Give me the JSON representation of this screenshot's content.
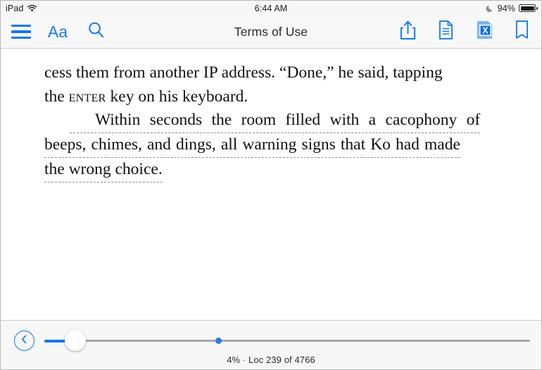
{
  "status_bar": {
    "device": "iPad",
    "wifi_icon": "wifi-icon",
    "time": "6:44 AM",
    "do_not_disturb_icon": "moon-icon",
    "battery_percent": "94%",
    "battery_icon": "battery-icon",
    "battery_level": 94
  },
  "toolbar": {
    "title": "Terms of Use",
    "menu_icon": "hamburger-menu-icon",
    "font_label": "Aa",
    "search_icon": "search-icon",
    "share_icon": "share-icon",
    "notes_icon": "notebook-icon",
    "xray_icon": "x-ray-icon",
    "bookmark_icon": "bookmark-icon"
  },
  "content": {
    "paragraph_1": {
      "line_1": "cess them from another IP address. “Done,” he said, tapping",
      "line_2_before": "the ",
      "line_2_smallcaps": "enter",
      "line_2_after": " key on his keyboard."
    },
    "note_passage": {
      "line_1": "Within seconds the room filled with a cacophony of",
      "line_2": "beeps, chimes, and dings, all warning signs that Ko had made",
      "line_3": "the wrong choice.",
      "full_text": "Within seconds the room filled with a cacophony of beeps, chimes, and dings, all warning signs that Ko had made the wrong choice."
    }
  },
  "bottom_bar": {
    "back_button_icon": "chevron-left-circle-icon",
    "progress_label": "4% · Loc 239 of 4766",
    "slider": {
      "value_percent": 4,
      "marker_percent": 35
    }
  },
  "colors": {
    "accent_blue": "#1479e8",
    "marker_blue": "#2b7de0",
    "toolbar_bg": "#f8f8f8",
    "page_bg": "#ffffff",
    "note_underline": "#8c8c8c",
    "text": "#101010"
  }
}
